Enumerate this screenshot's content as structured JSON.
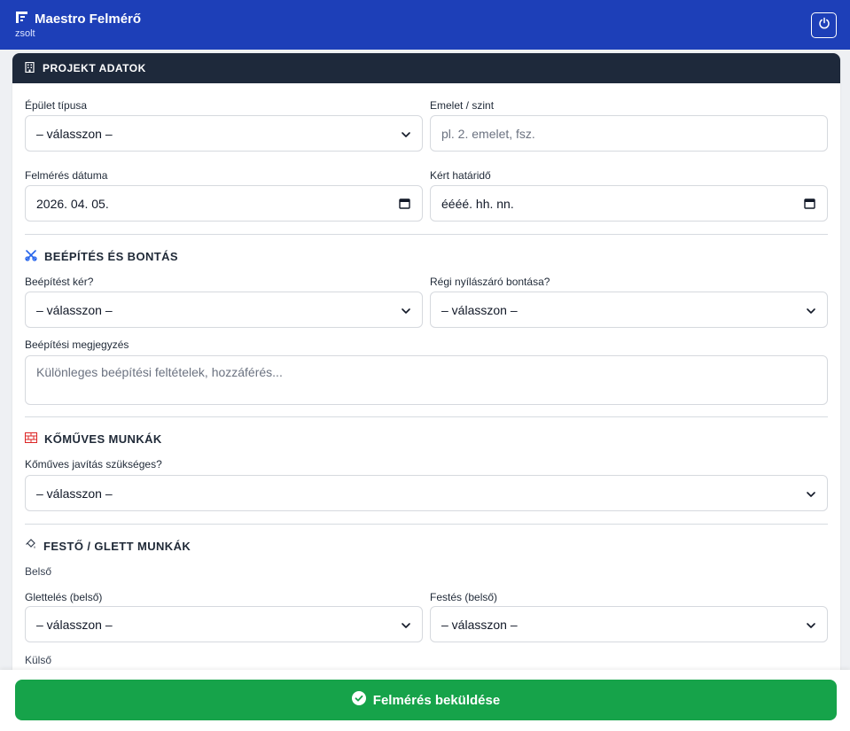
{
  "app": {
    "title": "Maestro Felmérő",
    "user": "zsolt"
  },
  "card": {
    "header": "PROJEKT ADATOK"
  },
  "project": {
    "building_type_label": "Épület típusa",
    "building_type_value": "– válasszon –",
    "floor_label": "Emelet / szint",
    "floor_placeholder": "pl. 2. emelet, fsz.",
    "survey_date_label": "Felmérés dátuma",
    "survey_date_value": "2026. 04. 05.",
    "deadline_label": "Kért határidő",
    "deadline_value": "éééé. hh. nn."
  },
  "installation": {
    "title": "BEÉPÍTÉS ÉS BONTÁS",
    "install_label": "Beépítést kér?",
    "install_value": "– válasszon –",
    "demolition_label": "Régi nyílászáró bontása?",
    "demolition_value": "– válasszon –",
    "note_label": "Beépítési megjegyzés",
    "note_placeholder": "Különleges beépítési feltételek, hozzáférés..."
  },
  "masonry": {
    "title": "KŐMŰVES MUNKÁK",
    "repair_label": "Kőműves javítás szükséges?",
    "repair_value": "– válasszon –"
  },
  "painting": {
    "title": "FESTŐ / GLETT MUNKÁK",
    "inner_label": "Belső",
    "plaster_label": "Glettelés (belső)",
    "plaster_value": "– válasszon –",
    "paint_label": "Festés (belső)",
    "paint_value": "– válasszon –",
    "outer_label": "Külső"
  },
  "footer": {
    "submit_label": "Felmérés beküldése"
  },
  "colors": {
    "topbar": "#1d3fb8",
    "card_header": "#1e293b",
    "submit": "#16a34a",
    "section_icon_blue": "#2563eb",
    "brick_red": "#dc2626"
  },
  "icons": [
    "building-flag-icon",
    "power-icon",
    "building-icon",
    "tools-icon",
    "brick-icon",
    "paint-icon",
    "chevron-down-icon",
    "calendar-icon",
    "check-circle-icon"
  ]
}
